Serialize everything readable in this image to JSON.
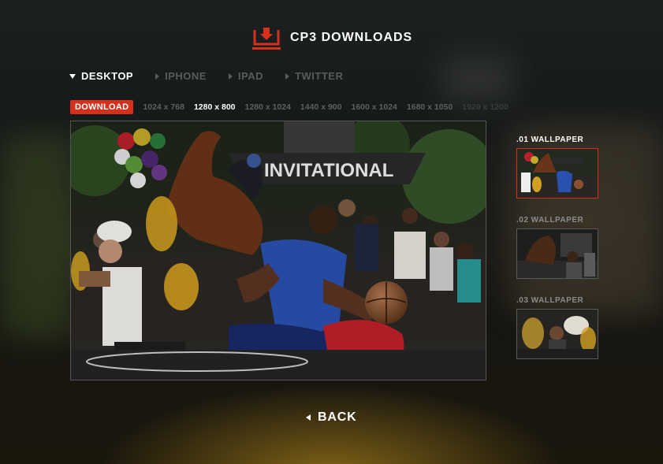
{
  "header": {
    "title": "CP3 DOWNLOADS",
    "icon": "download-tray-icon",
    "accent_color": "#d5301c"
  },
  "device_tabs": [
    {
      "label": "DESKTOP",
      "active": true
    },
    {
      "label": "IPHONE",
      "active": false
    },
    {
      "label": "IPAD",
      "active": false
    },
    {
      "label": "TWITTER",
      "active": false
    }
  ],
  "resolutions": {
    "download_label": "DOWNLOAD",
    "items": [
      {
        "label": "1024 x 768",
        "active": false
      },
      {
        "label": "1280 x 800",
        "active": true
      },
      {
        "label": "1280 x 1024",
        "active": false
      },
      {
        "label": "1440 x 900",
        "active": false
      },
      {
        "label": "1600 x 1024",
        "active": false
      },
      {
        "label": "1680 x 1050",
        "active": false
      },
      {
        "label": "1920 x 1200",
        "active": false
      }
    ]
  },
  "preview": {
    "banner_text": "INVITATIONAL"
  },
  "wallpapers": [
    {
      "label": ".01 WALLPAPER",
      "active": true
    },
    {
      "label": ".02 WALLPAPER",
      "active": false
    },
    {
      "label": ".03 WALLPAPER",
      "active": false
    }
  ],
  "back_label": "BACK"
}
